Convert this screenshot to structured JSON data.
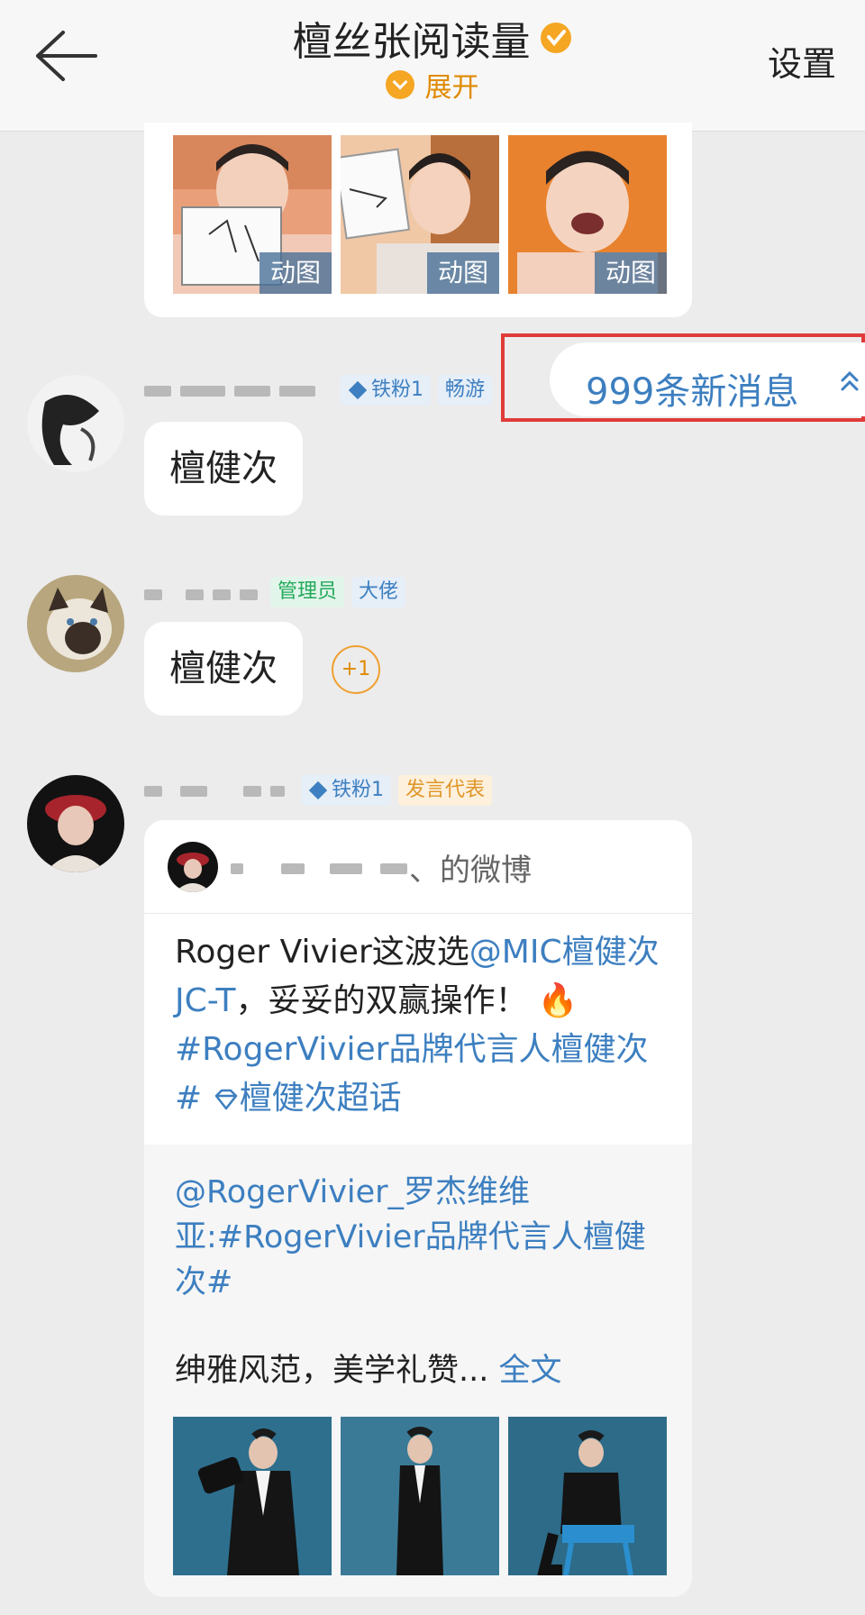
{
  "header": {
    "title": "檀丝张阅读量",
    "expand_label": "展开",
    "settings_label": "设置"
  },
  "top_card": {
    "gif_badges": [
      "动图",
      "动图",
      "动图"
    ]
  },
  "new_messages": {
    "label": "999条新消息"
  },
  "messages": [
    {
      "badges": [
        "铁粉1",
        "畅游"
      ],
      "text": "檀健次"
    },
    {
      "badges": [
        "管理员",
        "大佬"
      ],
      "text": "檀健次",
      "reaction": "+1"
    },
    {
      "badges": [
        "铁粉1",
        "发言代表"
      ]
    }
  ],
  "weibo_card": {
    "header_suffix": "、的微博",
    "body_prefix": "Roger Vivier这波选",
    "mention": "@MIC檀健次JC-T",
    "body_mid": "，妥妥的双赢操作！",
    "fire_emoji": "🔥",
    "hashtag": "#RogerVivier品牌代言人檀健次#",
    "supertopic": "檀健次超话",
    "quote_mention": "@RogerVivier_罗杰维维亚",
    "quote_text": ":#RogerVivier品牌代言人檀健次#",
    "summary": "绅雅风范，美学礼赞...",
    "full_text_link": "全文"
  },
  "colors": {
    "accent_blue": "#3d7fc0",
    "highlight_red": "#e03a3a",
    "admin_green": "#22a95a",
    "rep_orange": "#e0962a",
    "expand_orange": "#f5a623"
  }
}
